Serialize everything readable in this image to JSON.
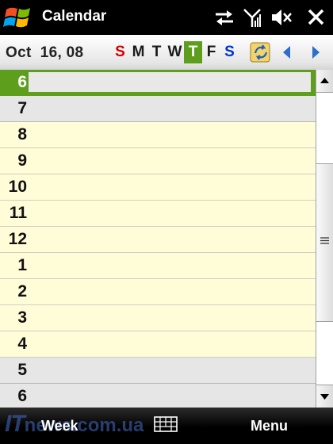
{
  "title_bar": {
    "app_title": "Calendar",
    "icons": [
      "windows-start-icon",
      "connectivity-icon",
      "signal-icon",
      "volume-muted-icon",
      "close-icon"
    ]
  },
  "date_bar": {
    "date": "Oct  16, 08",
    "weekdays": [
      {
        "label": "S",
        "kind": "sun"
      },
      {
        "label": "M",
        "kind": ""
      },
      {
        "label": "T",
        "kind": ""
      },
      {
        "label": "W",
        "kind": ""
      },
      {
        "label": "T",
        "kind": "today"
      },
      {
        "label": "F",
        "kind": ""
      },
      {
        "label": "S",
        "kind": "sat"
      }
    ]
  },
  "hours": [
    {
      "label": "6",
      "state": "selected"
    },
    {
      "label": "7",
      "state": "off"
    },
    {
      "label": "8",
      "state": "work"
    },
    {
      "label": "9",
      "state": "work"
    },
    {
      "label": "10",
      "state": "work"
    },
    {
      "label": "11",
      "state": "work"
    },
    {
      "label": "12",
      "state": "work"
    },
    {
      "label": "1",
      "state": "work"
    },
    {
      "label": "2",
      "state": "work"
    },
    {
      "label": "3",
      "state": "work"
    },
    {
      "label": "4",
      "state": "work"
    },
    {
      "label": "5",
      "state": "off"
    },
    {
      "label": "6",
      "state": "off"
    }
  ],
  "softkeys": {
    "left": "Week",
    "right": "Menu"
  },
  "watermark": {
    "main": "IT",
    "rest": "news.com.ua"
  },
  "colors": {
    "accent_green": "#5e9e1d",
    "work_hours_bg": "#fffcd8",
    "off_hours_bg": "#e6e6e6",
    "sunday": "#d40000",
    "saturday": "#0033cc"
  }
}
